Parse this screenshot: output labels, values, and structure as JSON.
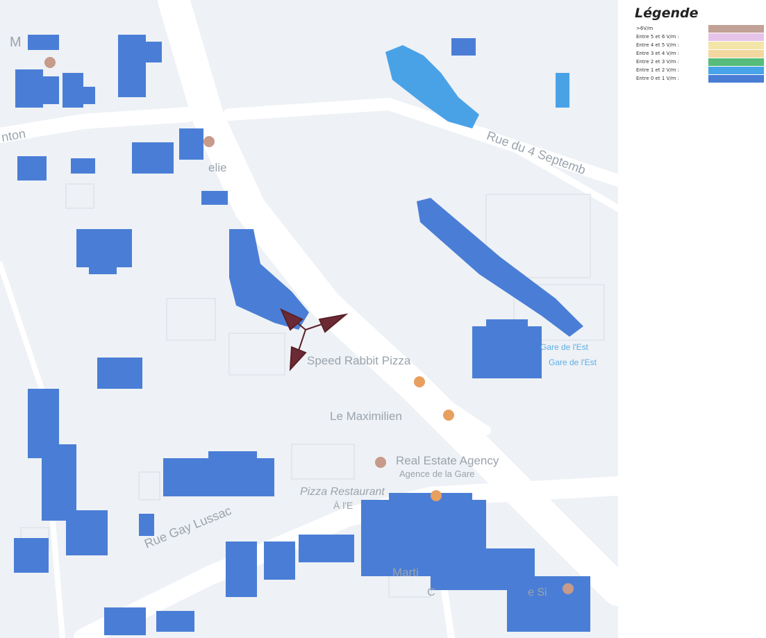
{
  "map": {
    "streets": {
      "rue_gay_lussac": "Rue Gay Lussac",
      "rue_du_4_septembre": "Rue du 4 Septemb",
      "top_left_fragment": "M",
      "left_fragment": "nton",
      "pizza_restaurant_fragment": "Pizza Restaurant",
      "pizza_sub_fragment": "À l'E"
    },
    "pois": {
      "speed_rabbit": "Speed Rabbit Pizza",
      "le_maximilien": "Le Maximilien",
      "real_estate": "Real Estate Agency",
      "real_estate_sub": "Agence de la Gare",
      "marti": "Marti",
      "bottom_fragment": "C",
      "bottom_fragment2": "e Si",
      "elie": "elie",
      "gare_fragment": "Gare de l'Est",
      "gare_fragment2": "Gare de l'Est"
    },
    "colors": {
      "background": "#eef1f5",
      "road": "#ffffff",
      "level_0_1": "#4a7ed6",
      "level_1_2": "#4aa2e6",
      "antenna": "#6b2a34",
      "poi_orange": "#e8a060",
      "poi_pink": "#c79a8a"
    }
  },
  "legend": {
    "title": "Légende",
    "items": [
      {
        "label": ">6V/m",
        "color": "#c2a196"
      },
      {
        "label": "Entre 5 et 6 V/m :",
        "color": "#e6c3e8"
      },
      {
        "label": "Entre 4 et 5 V/m :",
        "color": "#f3e5a8"
      },
      {
        "label": "Entre 3 et 4 V/m :",
        "color": "#f2d79e"
      },
      {
        "label": "Entre 2 et 3 V/m :",
        "color": "#55bc7a"
      },
      {
        "label": "Entre 1 et 2 V/m :",
        "color": "#48a4e8"
      },
      {
        "label": "Entre 0 et 1 V/m :",
        "color": "#4a7ed6"
      }
    ]
  }
}
